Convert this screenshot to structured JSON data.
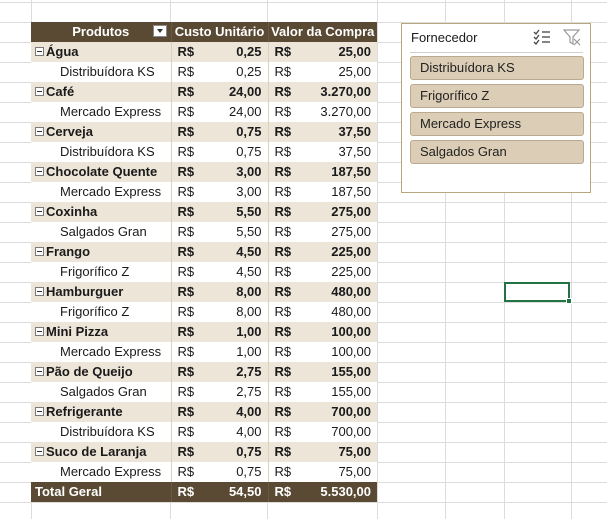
{
  "pivot": {
    "headers": {
      "produtos": "Produtos",
      "custo": "Custo Unitário",
      "valor": "Valor da Compra"
    },
    "currency": "R$",
    "rows": [
      {
        "type": "prod",
        "label": "Água",
        "custo": "0,25",
        "valor": "25,00"
      },
      {
        "type": "sub",
        "label": "Distribuídora KS",
        "custo": "0,25",
        "valor": "25,00"
      },
      {
        "type": "prod",
        "label": "Café",
        "custo": "24,00",
        "valor": "3.270,00"
      },
      {
        "type": "sub",
        "label": "Mercado Express",
        "custo": "24,00",
        "valor": "3.270,00"
      },
      {
        "type": "prod",
        "label": "Cerveja",
        "custo": "0,75",
        "valor": "37,50"
      },
      {
        "type": "sub",
        "label": "Distribuídora KS",
        "custo": "0,75",
        "valor": "37,50"
      },
      {
        "type": "prod",
        "label": "Chocolate Quente",
        "custo": "3,00",
        "valor": "187,50"
      },
      {
        "type": "sub",
        "label": "Mercado Express",
        "custo": "3,00",
        "valor": "187,50"
      },
      {
        "type": "prod",
        "label": "Coxinha",
        "custo": "5,50",
        "valor": "275,00"
      },
      {
        "type": "sub",
        "label": "Salgados Gran",
        "custo": "5,50",
        "valor": "275,00"
      },
      {
        "type": "prod",
        "label": "Frango",
        "custo": "4,50",
        "valor": "225,00"
      },
      {
        "type": "sub",
        "label": "Frigorífico Z",
        "custo": "4,50",
        "valor": "225,00"
      },
      {
        "type": "prod",
        "label": "Hamburguer",
        "custo": "8,00",
        "valor": "480,00"
      },
      {
        "type": "sub",
        "label": "Frigorífico Z",
        "custo": "8,00",
        "valor": "480,00"
      },
      {
        "type": "prod",
        "label": "Mini Pizza",
        "custo": "1,00",
        "valor": "100,00"
      },
      {
        "type": "sub",
        "label": "Mercado Express",
        "custo": "1,00",
        "valor": "100,00"
      },
      {
        "type": "prod",
        "label": "Pão de Queijo",
        "custo": "2,75",
        "valor": "155,00"
      },
      {
        "type": "sub",
        "label": "Salgados Gran",
        "custo": "2,75",
        "valor": "155,00"
      },
      {
        "type": "prod",
        "label": "Refrigerante",
        "custo": "4,00",
        "valor": "700,00"
      },
      {
        "type": "sub",
        "label": "Distribuídora KS",
        "custo": "4,00",
        "valor": "700,00"
      },
      {
        "type": "prod",
        "label": "Suco de Laranja",
        "custo": "0,75",
        "valor": "75,00"
      },
      {
        "type": "sub",
        "label": "Mercado Express",
        "custo": "0,75",
        "valor": "75,00"
      }
    ],
    "total": {
      "label": "Total Geral",
      "custo": "54,50",
      "valor": "5.530,00"
    }
  },
  "slicer": {
    "title": "Fornecedor",
    "items": [
      "Distribuídora KS",
      "Frigorífico Z",
      "Mercado Express",
      "Salgados Gran"
    ],
    "icons": {
      "multi_select": "multi-select-icon",
      "clear_filter": "clear-filter-icon"
    }
  },
  "colors": {
    "header_bg": "#5a4a34",
    "band_bg": "#ece5d8",
    "slicer_item_bg": "#dbcdb6",
    "selection": "#217346"
  }
}
